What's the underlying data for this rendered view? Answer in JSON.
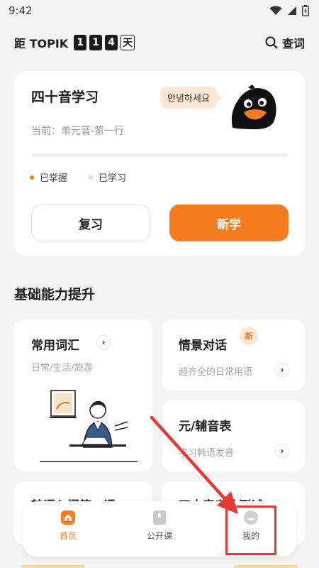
{
  "status_bar": {
    "time": "9:42"
  },
  "header": {
    "countdown_label": "距 TOPIK",
    "countdown_digits": [
      "1",
      "1",
      "4"
    ],
    "countdown_unit": "天",
    "lookup_label": "查词"
  },
  "main_card": {
    "title": "四十音学习",
    "bubble_text": "안녕하세요",
    "current_label": "当前：单元音-第一行",
    "progress_fraction": 0,
    "legend": {
      "mastered": "已掌握",
      "learned": "已学习"
    },
    "review_button": "复习",
    "new_button": "新学"
  },
  "section": {
    "title": "基础能力提升"
  },
  "cards": {
    "vocab": {
      "title": "常用词汇",
      "subtitle": "日常/生活/旅游"
    },
    "dialogue": {
      "title": "情景对话",
      "subtitle": "超齐全的日常用语",
      "badge": "新"
    },
    "vowels": {
      "title": "元/辅音表",
      "subtitle": "学习韩语发音"
    },
    "intro": {
      "title": "韩语入门第一课"
    },
    "test": {
      "title": "四十音专业测试"
    }
  },
  "bottom_nav": {
    "home": "首页",
    "courses": "公开课",
    "mine": "我的"
  },
  "colors": {
    "accent": "#f57c1f",
    "mastered_dot": "#f57c1f",
    "learned_dot": "#f9d4b6",
    "annotation": "#e53935"
  }
}
